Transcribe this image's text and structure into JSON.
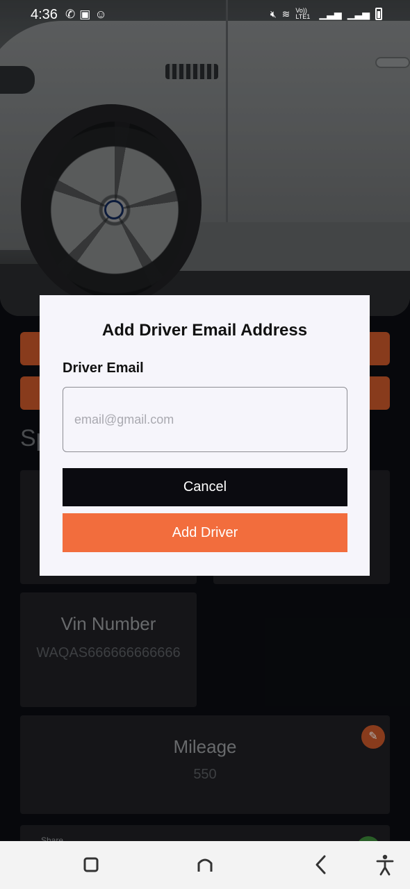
{
  "status_bar": {
    "time": "4:36",
    "left_icons": [
      "whatsapp-icon",
      "gallery-icon",
      "snapchat-icon"
    ],
    "right_icons": [
      "mute-icon",
      "wifi-icon",
      "volte-icon",
      "signal-icon",
      "signal-icon",
      "battery-icon"
    ],
    "network_label": "Vo)) LTE1"
  },
  "background": {
    "section_title_partial": "Sp",
    "cards": [
      {
        "title": "Vin Number",
        "value": "WAQAS666666666666"
      },
      {
        "title": "Mileage",
        "value": "550"
      }
    ],
    "share_label": "Share"
  },
  "dialog": {
    "title": "Add Driver Email Address",
    "field_label": "Driver Email",
    "email_placeholder": "email@gmail.com",
    "email_value": "",
    "cancel_label": "Cancel",
    "add_label": "Add Driver"
  },
  "colors": {
    "accent": "#f26d3d",
    "dialog_bg": "#f6f5fb",
    "cancel_bg": "#0b0b10"
  },
  "nav_bar": {
    "buttons": [
      "recents-icon",
      "home-icon",
      "back-icon",
      "accessibility-icon"
    ]
  }
}
